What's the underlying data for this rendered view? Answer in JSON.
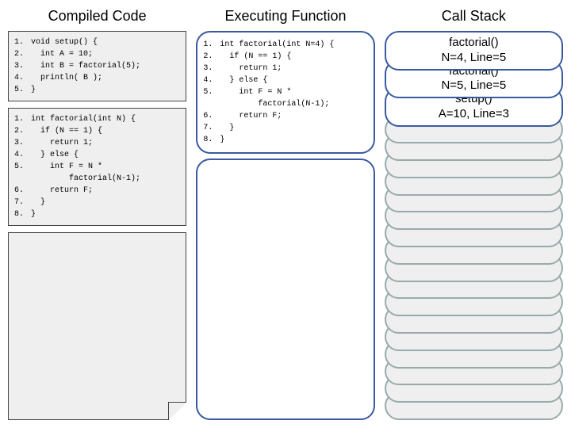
{
  "columns": {
    "compiled": "Compiled Code",
    "executing": "Executing Function",
    "callstack": "Call Stack"
  },
  "compiled": {
    "setup": [
      {
        "n": "1.",
        "t": "void setup() {"
      },
      {
        "n": "2.",
        "t": "  int A = 10;"
      },
      {
        "n": "3.",
        "t": "  int B = factorial(5);"
      },
      {
        "n": "4.",
        "t": "  println( B );"
      },
      {
        "n": "5.",
        "t": "}"
      }
    ],
    "factorial": [
      {
        "n": "1.",
        "t": "int factorial(int N) {"
      },
      {
        "n": "2.",
        "t": "  if (N == 1) {"
      },
      {
        "n": "3.",
        "t": "    return 1;"
      },
      {
        "n": "4.",
        "t": "  } else {"
      },
      {
        "n": "5.",
        "t": "    int F = N *"
      },
      {
        "n": "",
        "t": "        factorial(N-1);"
      },
      {
        "n": "6.",
        "t": "    return F;"
      },
      {
        "n": "7.",
        "t": "  }"
      },
      {
        "n": "8.",
        "t": "}"
      }
    ]
  },
  "executing": [
    {
      "n": "1.",
      "t": "int factorial(int N=4) {"
    },
    {
      "n": "2.",
      "t": "  if (N == 1) {"
    },
    {
      "n": "3.",
      "t": "    return 1;"
    },
    {
      "n": "4.",
      "t": "  } else {"
    },
    {
      "n": "5.",
      "t": "    int F = N *"
    },
    {
      "n": "",
      "t": "        factorial(N-1);"
    },
    {
      "n": "6.",
      "t": "    return F;"
    },
    {
      "n": "7.",
      "t": "  }"
    },
    {
      "n": "8.",
      "t": "}"
    }
  ],
  "stack": [
    {
      "fn": "factorial()",
      "detail": "N=4, Line=5"
    },
    {
      "fn": "factorial()",
      "detail": "N=5, Line=5"
    },
    {
      "fn": "setup()",
      "detail": "A=10, Line=3"
    }
  ],
  "empty_frames": 17
}
